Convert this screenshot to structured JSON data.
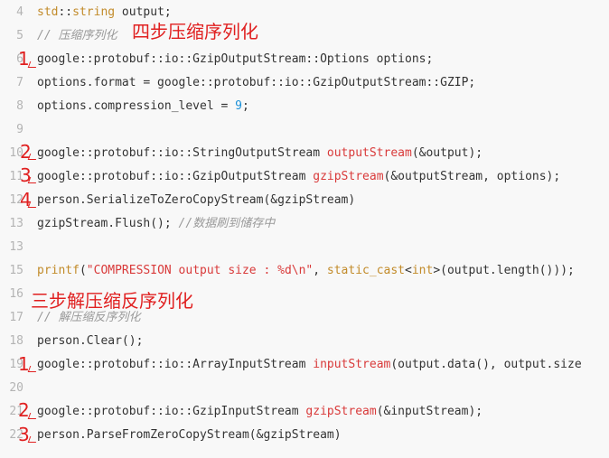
{
  "code": {
    "lines": [
      {
        "n": "4",
        "text": "std::string output;"
      },
      {
        "n": "5",
        "text": "// 压缩序列化"
      },
      {
        "n": "6",
        "text": "google::protobuf::io::GzipOutputStream::Options options;"
      },
      {
        "n": "7",
        "text": "options.format = google::protobuf::io::GzipOutputStream::GZIP;"
      },
      {
        "n": "8",
        "text": "options.compression_level = 9;"
      },
      {
        "n": "9",
        "text": ""
      },
      {
        "n": "10",
        "text": "google::protobuf::io::StringOutputStream outputStream(&output);"
      },
      {
        "n": "11",
        "text": "google::protobuf::io::GzipOutputStream gzipStream(&outputStream, options);"
      },
      {
        "n": "12",
        "text": "person.SerializeToZeroCopyStream(&gzipStream)"
      },
      {
        "n": "13",
        "text": "gzipStream.Flush(); //数据刷到储存中"
      },
      {
        "n": "13",
        "text": ""
      },
      {
        "n": "15",
        "text": "printf(\"COMPRESSION output size : %d\\n\", static_cast<int>(output.length()));"
      },
      {
        "n": "16",
        "text": ""
      },
      {
        "n": "17",
        "text": "// 解压缩反序列化"
      },
      {
        "n": "18",
        "text": "person.Clear();"
      },
      {
        "n": "19",
        "text": "google::protobuf::io::ArrayInputStream inputStream(output.data(), output.size"
      },
      {
        "n": "20",
        "text": ""
      },
      {
        "n": "21",
        "text": "google::protobuf::io::GzipInputStream gzipStream(&inputStream);"
      },
      {
        "n": "22",
        "text": "person.ParseFromZeroCopyStream(&gzipStream)"
      }
    ]
  },
  "annotations": {
    "compress_title": "四步压缩序列化",
    "decompress_title": "三步解压缩反序列化",
    "step1": "1",
    "step2": "2",
    "step3": "3",
    "step4": "4"
  },
  "colors": {
    "annotation": "#e02020",
    "keyword": "#c28b2a",
    "function": "#d93a3a",
    "comment": "#999999",
    "number": "#1a90d8",
    "line_number": "#b4b4b4"
  }
}
